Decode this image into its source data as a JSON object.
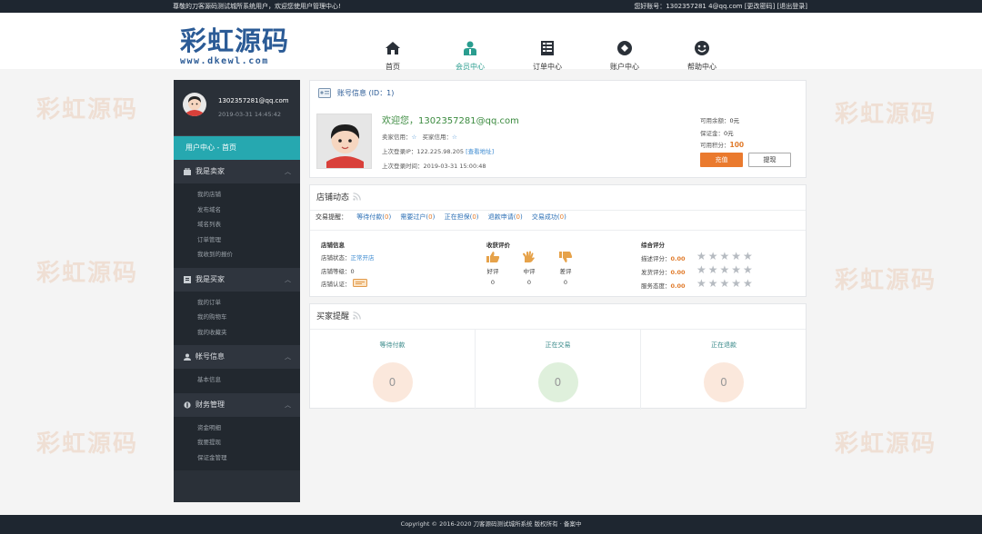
{
  "topbar": {
    "welcome": "尊敬的刀客源码测试城所系统用户，欢迎您使用户管理中心!",
    "account_prefix": "您好账号：",
    "account": "1302357281 4@qq.com",
    "switch_label": "[更改密码]",
    "logout_label": "[退出登录]"
  },
  "logo": {
    "text": "彩虹源码",
    "url": "www.dkewl.com"
  },
  "nav": [
    {
      "label": "首页",
      "icon": "home-icon"
    },
    {
      "label": "会员中心",
      "icon": "member-icon"
    },
    {
      "label": "订单中心",
      "icon": "order-icon"
    },
    {
      "label": "账户中心",
      "icon": "account-icon"
    },
    {
      "label": "帮助中心",
      "icon": "help-icon"
    }
  ],
  "watermark": "彩虹源码",
  "sidebar": {
    "email": "1302357281@qq.com",
    "datetime": "2019-03-31 14:45:42",
    "active": "用户中心 - 首页",
    "sections": [
      {
        "title": "我是卖家",
        "items": [
          "我的店铺",
          "发布域名",
          "域名列表",
          "订单管理",
          "我收到的报价"
        ]
      },
      {
        "title": "我是买家",
        "items": [
          "我的订单",
          "我的购物车",
          "我的收藏夹"
        ]
      },
      {
        "title": "帐号信息",
        "items": [
          "基本信息"
        ]
      },
      {
        "title": "财务管理",
        "items": [
          "资金明细",
          "我要提现",
          "保证金管理"
        ]
      }
    ]
  },
  "account": {
    "title": "账号信息",
    "id_text": "(ID：1)",
    "welcome": "欢迎您，1302357281@qq.com",
    "seller_credit_label": "卖家信用：",
    "buyer_credit_label": "买家信用：",
    "last_ip_label": "上次登录IP：",
    "last_ip": "122.225.98.205",
    "view_addr": "[查看地址]",
    "last_time_label": "上次登录时间：",
    "last_time": "2019-03-31 15:00:48",
    "balance_label": "可用余额：",
    "balance": "0元",
    "deposit_label": "保证金：",
    "deposit": "0元",
    "points_label": "可用积分：",
    "points": "100",
    "recharge_label": "充值",
    "withdraw_label": "提现"
  },
  "store": {
    "title": "店铺动态",
    "trade_label": "交易提醒：",
    "trades": [
      {
        "label": "等待付款",
        "count": "0"
      },
      {
        "label": "需要过户",
        "count": "0"
      },
      {
        "label": "正在担保",
        "count": "0"
      },
      {
        "label": "退款申请",
        "count": "0"
      },
      {
        "label": "交易成功",
        "count": "0"
      }
    ],
    "info_title": "店铺信息",
    "status_label": "店铺状态：",
    "status": "正常开店",
    "level_label": "店铺等级：",
    "level": "0",
    "cert_label": "店铺认证：",
    "review_title": "收获评价",
    "reviews": [
      {
        "label": "好评",
        "count": "0"
      },
      {
        "label": "中评",
        "count": "0"
      },
      {
        "label": "差评",
        "count": "0"
      }
    ],
    "score_title": "综合评分",
    "scores": [
      {
        "label": "描述评分：",
        "value": "0.00"
      },
      {
        "label": "发货评分：",
        "value": "0.00"
      },
      {
        "label": "服务态度：",
        "value": "0.00"
      }
    ]
  },
  "buyer": {
    "title": "买家提醒",
    "cells": [
      {
        "label": "等待付款",
        "value": "0",
        "color": "#fbe8dc"
      },
      {
        "label": "正在交易",
        "value": "0",
        "color": "#dff0dc"
      },
      {
        "label": "正在退款",
        "value": "0",
        "color": "#fbe8dc"
      }
    ]
  },
  "footer": "Copyright © 2016-2020 刀客源码测试城所系统 版权所有 · 备案中"
}
